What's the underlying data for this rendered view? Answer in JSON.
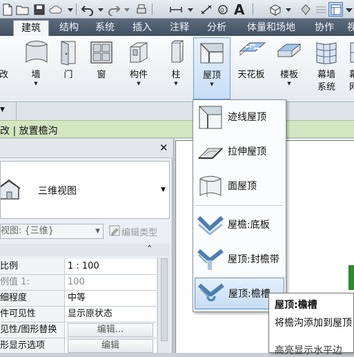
{
  "ribbon": {
    "tabs": [
      {
        "id": "architecture",
        "label": "建筑",
        "active": true
      },
      {
        "id": "structure",
        "label": "结构"
      },
      {
        "id": "systems",
        "label": "系统"
      },
      {
        "id": "insert",
        "label": "插入"
      },
      {
        "id": "annotate",
        "label": "注释"
      },
      {
        "id": "analyze",
        "label": "分析"
      },
      {
        "id": "massing",
        "label": "体量和场地"
      },
      {
        "id": "collaborate",
        "label": "协作"
      },
      {
        "id": "view-partial",
        "label": "视"
      }
    ],
    "tools": [
      {
        "id": "modify-partial",
        "label": "改"
      },
      {
        "id": "wall",
        "label": "墙"
      },
      {
        "id": "door",
        "label": "门"
      },
      {
        "id": "window",
        "label": "窗"
      },
      {
        "id": "component",
        "label": "构件"
      },
      {
        "id": "column",
        "label": "柱"
      },
      {
        "id": "roof",
        "label": "屋顶"
      },
      {
        "id": "ceiling",
        "label": "天花板"
      },
      {
        "id": "floor",
        "label": "楼板"
      },
      {
        "id": "curtain-system",
        "label": "幕墙",
        "label2": "系统"
      },
      {
        "id": "curtain-grid-partial",
        "label": "幕",
        "label2": "网"
      }
    ]
  },
  "context_bar": {
    "text": "改 | 放置檐沟"
  },
  "roof_menu": {
    "items": [
      {
        "id": "roof-by-footprint",
        "label": "迹线屋顶"
      },
      {
        "id": "roof-by-extrusion",
        "label": "拉伸屋顶"
      },
      {
        "id": "face-roof",
        "label": "面屋顶"
      },
      {
        "id": "roof-soffit",
        "label": "屋檐:底板"
      },
      {
        "id": "roof-fascia",
        "label": "屋顶:封檐带"
      },
      {
        "id": "roof-gutter",
        "label": "屋顶:檐槽",
        "hover": true
      }
    ]
  },
  "tooltip": {
    "title": "屋顶:檐槽",
    "body": "将檐沟添加到屋顶",
    "more": "高亮显示水平边"
  },
  "properties": {
    "type_name": "三维视图",
    "view_selector": "视图: {三维}",
    "edit_type_label": "编辑类型",
    "rows": [
      {
        "key": "比例",
        "value": "1 : 100"
      },
      {
        "key": "例值 1:",
        "value": "100",
        "grey": true
      },
      {
        "key": "细程度",
        "value": "中等"
      },
      {
        "key": "件可见性",
        "value": "显示原状态"
      },
      {
        "key": "见性/图形替换",
        "button": "编辑..."
      },
      {
        "key": "形显示选项",
        "button": "编辑"
      }
    ]
  },
  "colors": {
    "tab_bar": "#415062",
    "context_bar": "#d3e6c2",
    "selected": "#c9def6",
    "accent": "#6c9fd7"
  }
}
